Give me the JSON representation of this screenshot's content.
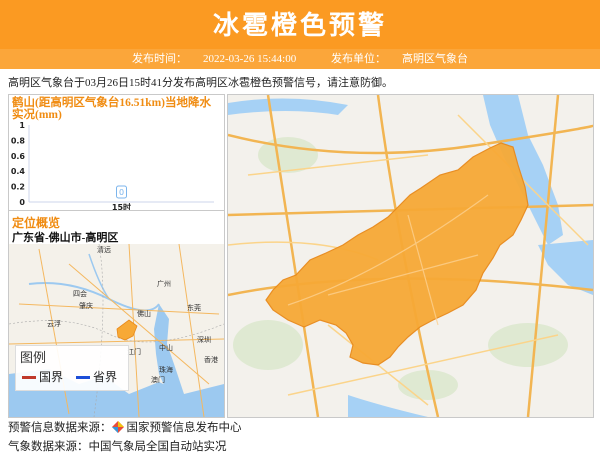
{
  "header": {
    "title": "冰雹橙色预警",
    "publish_time_label": "发布时间：",
    "publish_time": "2022-03-26 15:44:00",
    "publisher_label": "发布单位：",
    "publisher": "高明区气象台"
  },
  "description": "高明区气象台于03月26日15时41分发布高明区冰雹橙色预警信号，请注意防御。",
  "rain_chart": {
    "title": "鹤山(距高明区气象台16.51km)当地降水实况(mm)",
    "colors": {
      "title": "#f08c12",
      "bar": "#7cb5ec"
    }
  },
  "chart_data": {
    "type": "bar",
    "title": "鹤山(距高明区气象台16.51km)当地降水实况(mm)",
    "categories": [
      "15时"
    ],
    "values": [
      0
    ],
    "data_labels": [
      "0"
    ],
    "ylim": [
      0,
      1
    ],
    "yticks": [
      "0",
      "0.2",
      "0.4",
      "0.6",
      "0.8",
      "1"
    ],
    "grid": false
  },
  "location": {
    "title": "定位概览",
    "value": "广东省-佛山市-高明区",
    "legend_title": "图例",
    "legend_items": [
      {
        "label": "国界",
        "color": "#c0392b"
      },
      {
        "label": "省界",
        "color": "#1d4ed8"
      }
    ]
  },
  "locator_map": {
    "place_labels": [
      "清远",
      "广州",
      "四会",
      "肇庆",
      "佛山",
      "东莞",
      "云浮",
      "江门",
      "中山",
      "深圳",
      "香港",
      "澳门",
      "珠海"
    ],
    "colors": {
      "water": "#9cc9f0",
      "land": "#f4f1ea",
      "highlight": "#f7a936"
    }
  },
  "main_map": {
    "colors": {
      "warning_area": "#f7a936",
      "water": "#a6d1f5",
      "land": "#f3f1ec"
    }
  },
  "footer": {
    "warning_source": "预警信息数据来源：",
    "warning_source_name": "国家预警信息发布中心",
    "weather_source": "气象数据来源：中国气象局全国自动站实况"
  }
}
